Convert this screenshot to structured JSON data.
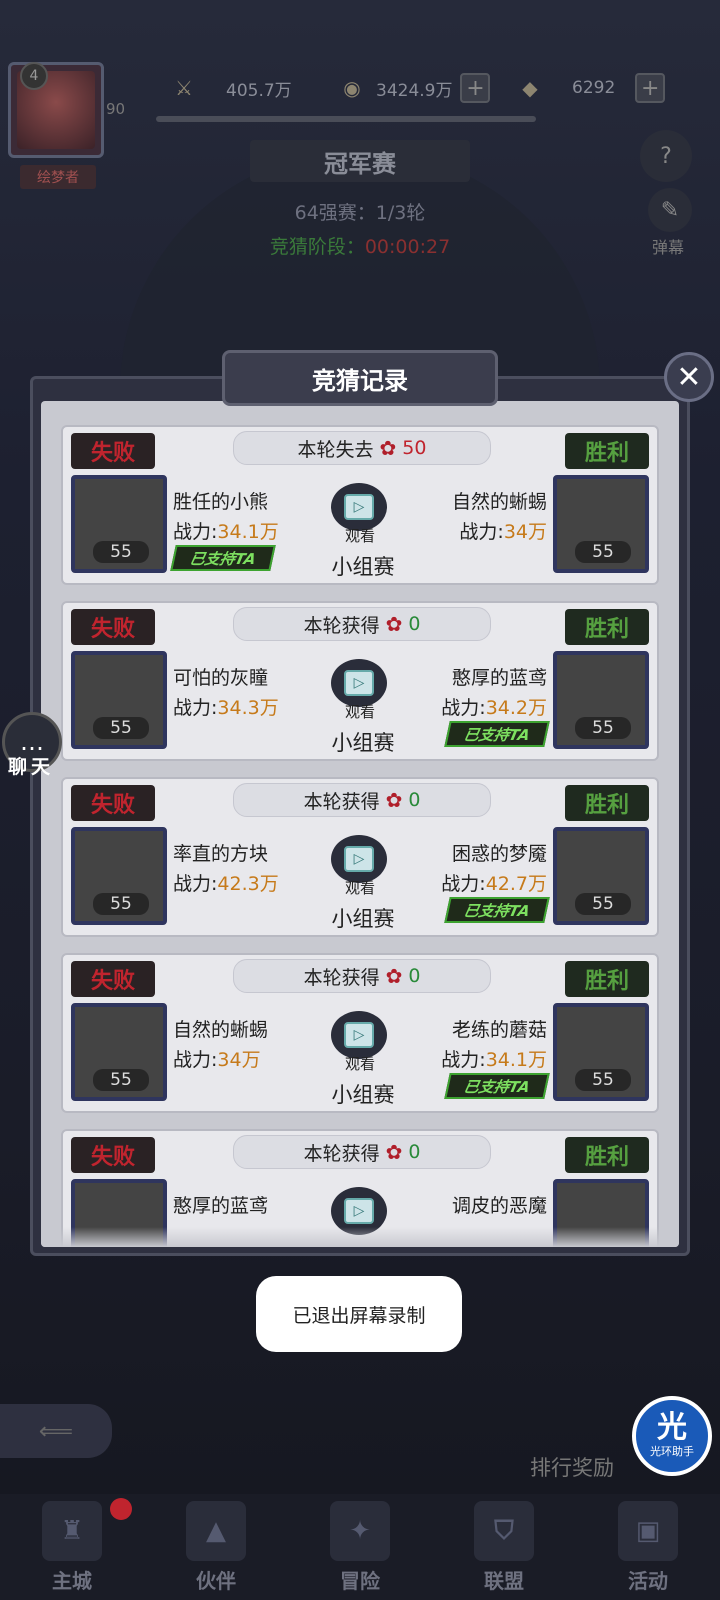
{
  "player": {
    "level": "4",
    "exp": "90",
    "nickname": "绘梦者"
  },
  "resources": [
    {
      "icon": "sword-icon",
      "value": "405.7万"
    },
    {
      "icon": "coin-icon",
      "value": "3424.9万"
    },
    {
      "icon": "diamond-icon",
      "value": "6292"
    }
  ],
  "event": {
    "title": "冠军赛",
    "round": "64强赛：1/3轮",
    "phase_label": "竞猜阶段：",
    "phase_time": "00:00:27"
  },
  "side": {
    "help": "?",
    "danmu": "弹幕"
  },
  "modal": {
    "title": "竞猜记录",
    "close": "✕"
  },
  "records": [
    {
      "banner_label": "本轮失去",
      "amount": "50",
      "amount_type": "lose",
      "left": {
        "result": "失败",
        "name": "胜任的小熊",
        "power_label": "战力:",
        "power": "34.1万",
        "level": "55",
        "supported": true
      },
      "right": {
        "result": "胜利",
        "name": "自然的蜥蜴",
        "power_label": "战力:",
        "power": "34万",
        "level": "55",
        "supported": false
      },
      "watch": "观看",
      "stage": "小组赛"
    },
    {
      "banner_label": "本轮获得",
      "amount": "0",
      "amount_type": "win",
      "left": {
        "result": "失败",
        "name": "可怕的灰瞳",
        "power_label": "战力:",
        "power": "34.3万",
        "level": "55",
        "supported": false
      },
      "right": {
        "result": "胜利",
        "name": "憨厚的蓝鸢",
        "power_label": "战力:",
        "power": "34.2万",
        "level": "55",
        "supported": true
      },
      "watch": "观看",
      "stage": "小组赛"
    },
    {
      "banner_label": "本轮获得",
      "amount": "0",
      "amount_type": "win",
      "left": {
        "result": "失败",
        "name": "率直的方块",
        "power_label": "战力:",
        "power": "42.3万",
        "level": "55",
        "supported": false
      },
      "right": {
        "result": "胜利",
        "name": "困惑的梦魇",
        "power_label": "战力:",
        "power": "42.7万",
        "level": "55",
        "supported": true
      },
      "watch": "观看",
      "stage": "小组赛"
    },
    {
      "banner_label": "本轮获得",
      "amount": "0",
      "amount_type": "win",
      "left": {
        "result": "失败",
        "name": "自然的蜥蜴",
        "power_label": "战力:",
        "power": "34万",
        "level": "55",
        "supported": false
      },
      "right": {
        "result": "胜利",
        "name": "老练的蘑菇",
        "power_label": "战力:",
        "power": "34.1万",
        "level": "55",
        "supported": true
      },
      "watch": "观看",
      "stage": "小组赛"
    },
    {
      "banner_label": "本轮获得",
      "amount": "0",
      "amount_type": "win",
      "left": {
        "result": "失败",
        "name": "憨厚的蓝鸢",
        "power_label": "",
        "power": "",
        "level": "",
        "supported": false
      },
      "right": {
        "result": "胜利",
        "name": "调皮的恶魔",
        "power_label": "",
        "power": "",
        "level": "",
        "supported": false
      },
      "watch": "",
      "stage": ""
    }
  ],
  "support_label": "已支持TA",
  "toast": "已退出屏幕录制",
  "chat": {
    "label": "聊天"
  },
  "rank_reward": "排行奖励",
  "assistant": {
    "big": "光",
    "small": "光环助手"
  },
  "nav": [
    {
      "label": "主城",
      "icon": "castle-icon"
    },
    {
      "label": "伙伴",
      "icon": "wizard-hat-icon"
    },
    {
      "label": "冒险",
      "icon": "compass-icon"
    },
    {
      "label": "联盟",
      "icon": "shield-icon"
    },
    {
      "label": "活动",
      "icon": "cards-icon"
    }
  ],
  "colors": {
    "lose": "#c0242e",
    "win": "#2a8a3a",
    "power": "#c67a1a",
    "support": "#3da330"
  }
}
